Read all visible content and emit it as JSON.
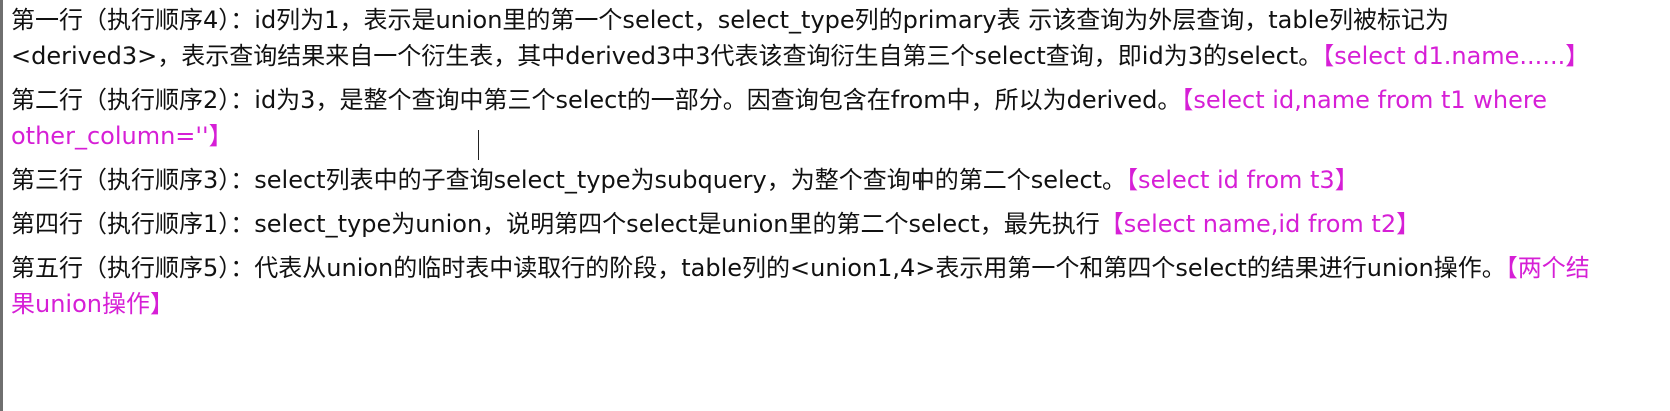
{
  "paragraphs": [
    {
      "prefix": "第一行（执行顺序4）：",
      "body": "id列为1，表示是union里的第一个select，select_type列的primary表 示该查询为外层查询，table列被标记为<derived3>，表示查询结果来自一个衍生表，其中derived3中3代表该查询衍生自第三个select查询，即id为3的select。",
      "highlight": "【select d1.name......】"
    },
    {
      "prefix": "第二行（执行顺序2）：",
      "body": "id为3，是整个查询中第三个select的一部分。因查询包含在from中，所以为derived。",
      "highlight": "【select id,name from t1 where other_column=''】"
    },
    {
      "prefix": "第三行（执行顺序3）：",
      "body": "select列表中的子查询select_type为subquery，为整个查询中的第二个select。",
      "highlight": "【select id from t3】"
    },
    {
      "prefix": "第四行（执行顺序1）：",
      "body": "select_type为union，说明第四个select是union里的第二个select，最先执行",
      "highlight": "【select name,id from t2】"
    },
    {
      "prefix": "第五行（执行顺序5）：",
      "body": "代表从union的临时表中读取行的阶段，table列的<union1,4>表示用第一个和第四个select的结果进行union操作。",
      "highlight": "【两个结果union操作】"
    }
  ],
  "colors": {
    "text": "#111111",
    "highlight": "#d61fd6",
    "left_border": "#6f6f6f"
  },
  "icons": {
    "text_caret": "text-caret",
    "mouse_pointer": "i-beam-cursor"
  }
}
